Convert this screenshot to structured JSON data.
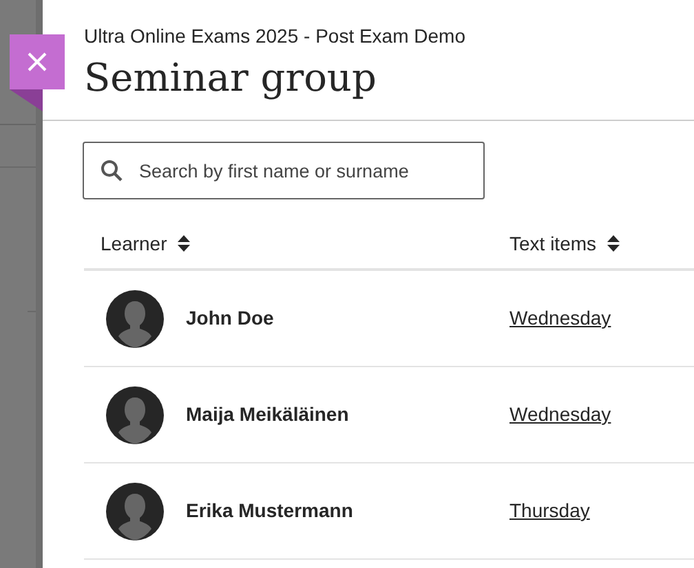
{
  "panel": {
    "course": "Ultra Online Exams 2025 - Post Exam Demo",
    "title": "Seminar group"
  },
  "search": {
    "placeholder": "Search by first name or surname"
  },
  "table": {
    "columns": [
      "Learner",
      "Text items"
    ],
    "rows": [
      {
        "name": "John Doe",
        "text_item": "Wednesday"
      },
      {
        "name": "Maija Meikäläinen",
        "text_item": "Wednesday"
      },
      {
        "name": "Erika Mustermann",
        "text_item": "Thursday"
      }
    ]
  }
}
